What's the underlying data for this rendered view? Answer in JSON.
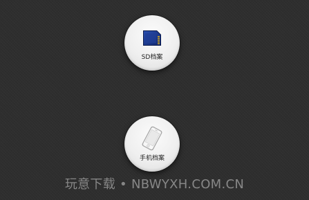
{
  "buttons": {
    "sd_archive": {
      "label": "SD档案",
      "icon": "sd-card-icon"
    },
    "phone_archive": {
      "label": "手机档案",
      "icon": "smartphone-icon"
    }
  },
  "watermark": {
    "text": "玩意下载 • NBWYXH.COM.CN"
  },
  "colors": {
    "background": "#2e2e2e",
    "button_face": "#efefef",
    "sd_card_blue": "#1e3a8a",
    "sd_card_gold": "#c9a227",
    "label_text": "#222222"
  }
}
